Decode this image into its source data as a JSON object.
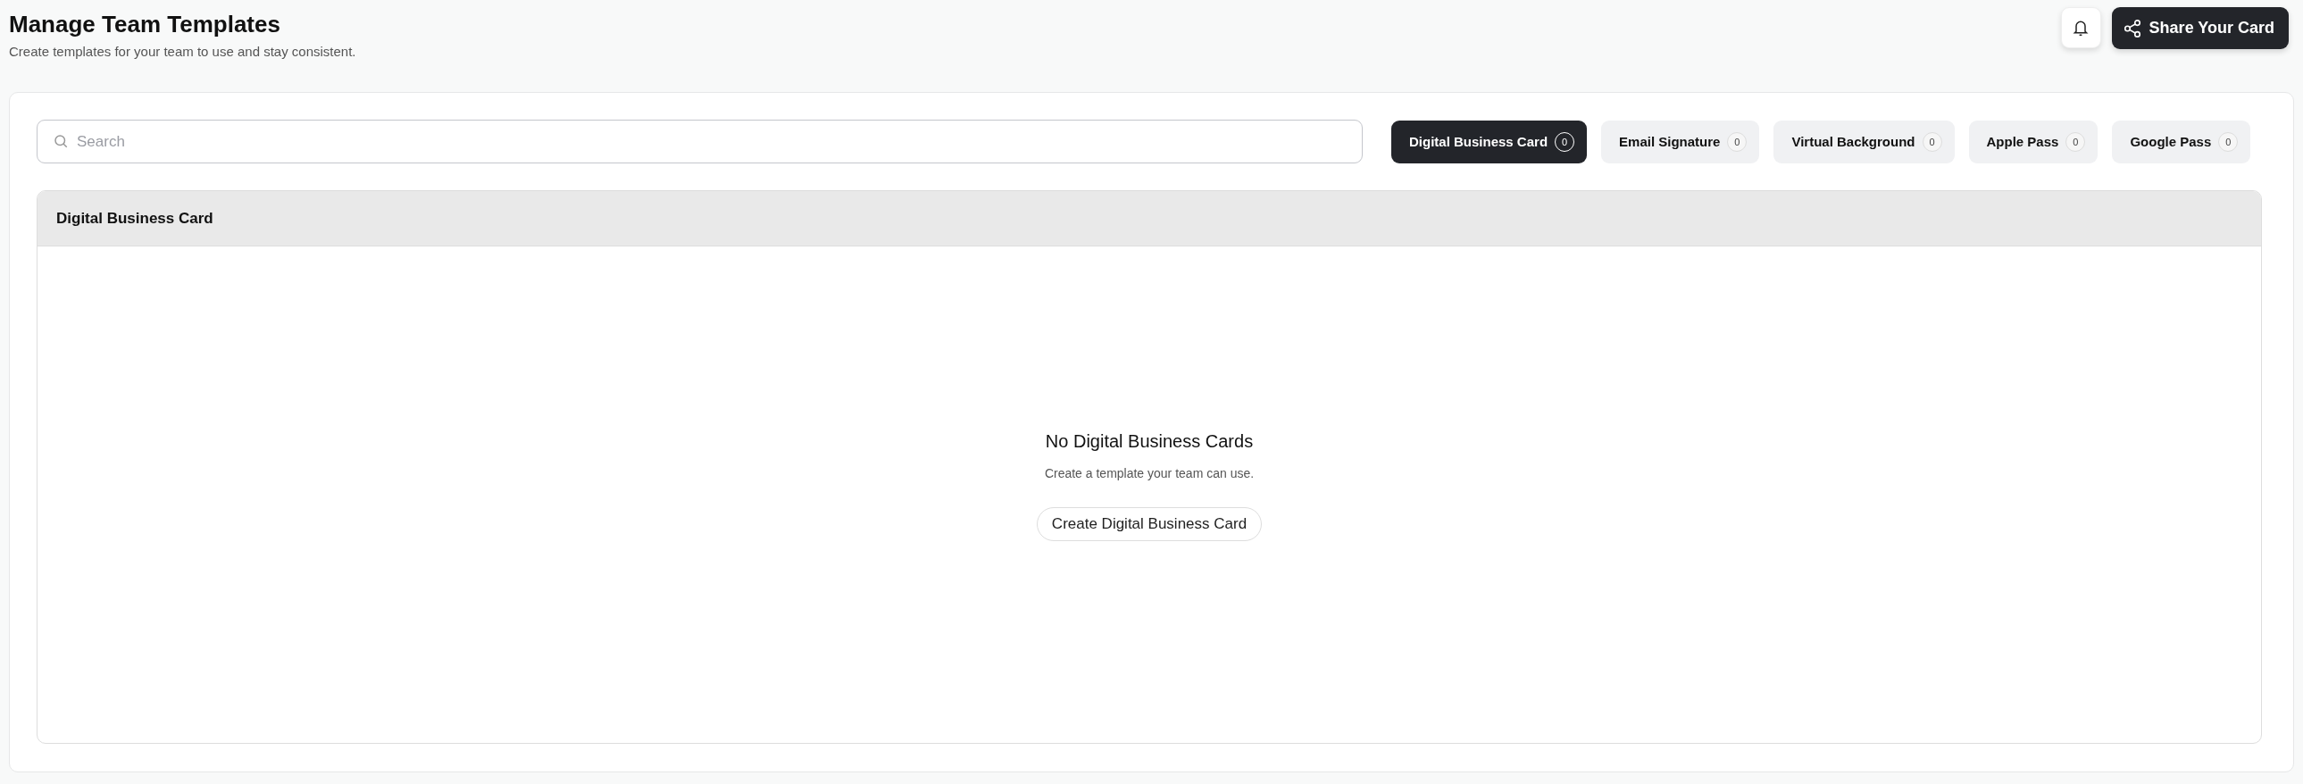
{
  "header": {
    "title": "Manage Team Templates",
    "subtitle": "Create templates for your team to use and stay consistent.",
    "share_button": "Share Your Card"
  },
  "search": {
    "placeholder": "Search"
  },
  "tabs": [
    {
      "label": "Digital Business Card",
      "count": "0",
      "selected": true
    },
    {
      "label": "Email Signature",
      "count": "0",
      "selected": false
    },
    {
      "label": "Virtual Background",
      "count": "0",
      "selected": false
    },
    {
      "label": "Apple Pass",
      "count": "0",
      "selected": false
    },
    {
      "label": "Google Pass",
      "count": "0",
      "selected": false
    }
  ],
  "panel": {
    "title": "Digital Business Card",
    "empty_title": "No Digital Business Cards",
    "empty_text": "Create a template your team can use.",
    "create_button": "Create Digital Business Card"
  }
}
